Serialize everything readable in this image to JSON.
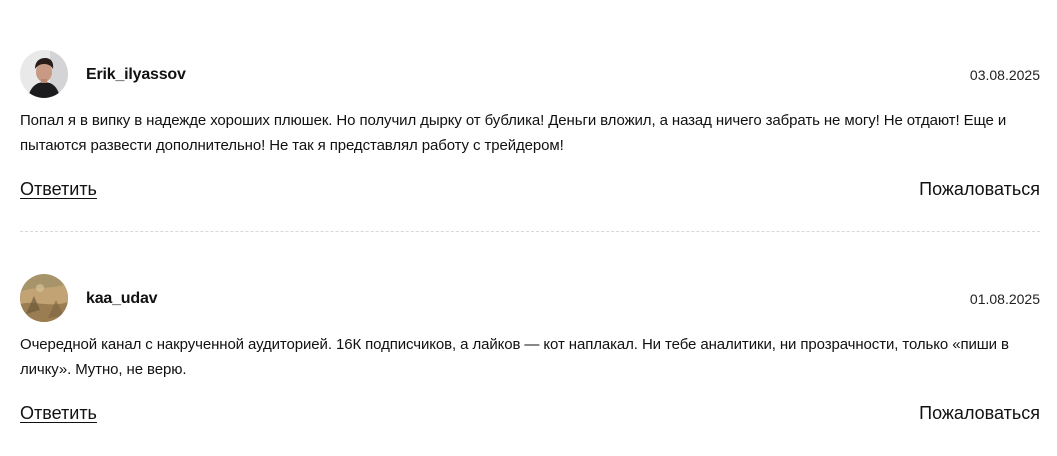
{
  "comments": [
    {
      "username": "Erik_ilyassov",
      "date": "03.08.2025",
      "text": "Попал я в випку в надежде хороших плюшек. Но получил дырку от бублика! Деньги вложил, а назад ничего забрать не могу! Не отдают! Еще и пытаются развести дополнительно! Не так я представлял работу с трейдером!",
      "reply_label": "Ответить",
      "report_label": "Пожаловаться"
    },
    {
      "username": "kaa_udav",
      "date": "01.08.2025",
      "text": "Очередной канал с накрученной аудиторией. 16К подписчиков, а лайков — кот наплакал. Ни тебе аналитики, ни прозрачности, только «пиши в личку». Мутно, не верю.",
      "reply_label": "Ответить",
      "report_label": "Пожаловаться"
    }
  ]
}
